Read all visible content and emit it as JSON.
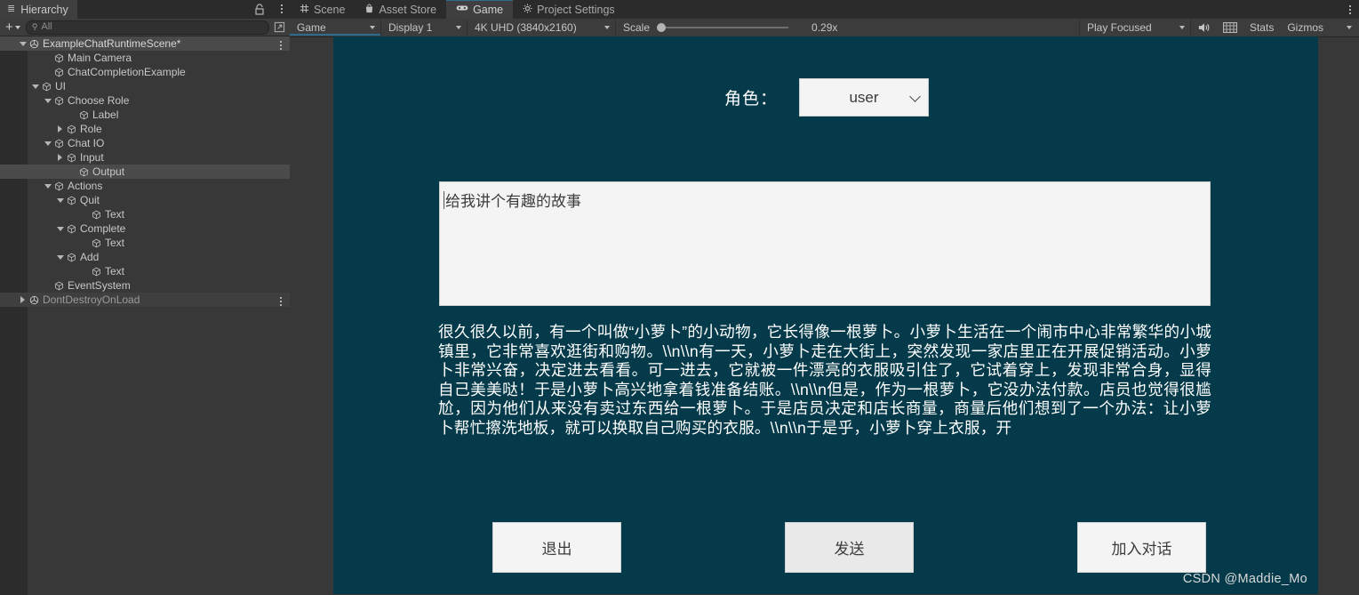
{
  "hierarchy": {
    "tab_label": "Hierarchy",
    "tab_icon": "hierarchy-icon",
    "search_placeholder": "All",
    "add_label": "+",
    "tree": [
      {
        "label": "ExampleChatRuntimeScene*",
        "depth": 0,
        "twisty": "open",
        "icon": "scene-icon",
        "state": "scene",
        "kebab": true
      },
      {
        "label": "Main Camera",
        "depth": 2,
        "twisty": "none",
        "icon": "object-icon",
        "state": "normal",
        "kebab": false
      },
      {
        "label": "ChatCompletionExample",
        "depth": 2,
        "twisty": "none",
        "icon": "object-icon",
        "state": "normal",
        "kebab": false
      },
      {
        "label": "UI",
        "depth": 1,
        "twisty": "open",
        "icon": "object-icon",
        "state": "normal",
        "kebab": false
      },
      {
        "label": "Choose Role",
        "depth": 2,
        "twisty": "open",
        "icon": "object-icon",
        "state": "normal",
        "kebab": false
      },
      {
        "label": "Label",
        "depth": 4,
        "twisty": "none",
        "icon": "object-icon",
        "state": "normal",
        "kebab": false
      },
      {
        "label": "Role",
        "depth": 3,
        "twisty": "closed",
        "icon": "object-icon",
        "state": "normal",
        "kebab": false
      },
      {
        "label": "Chat IO",
        "depth": 2,
        "twisty": "open",
        "icon": "object-icon",
        "state": "normal",
        "kebab": false
      },
      {
        "label": "Input",
        "depth": 3,
        "twisty": "closed",
        "icon": "object-icon",
        "state": "normal",
        "kebab": false
      },
      {
        "label": "Output",
        "depth": 4,
        "twisty": "none",
        "icon": "object-icon",
        "state": "selected",
        "kebab": false
      },
      {
        "label": "Actions",
        "depth": 2,
        "twisty": "open",
        "icon": "object-icon",
        "state": "normal",
        "kebab": false
      },
      {
        "label": "Quit",
        "depth": 3,
        "twisty": "open",
        "icon": "object-icon",
        "state": "normal",
        "kebab": false
      },
      {
        "label": "Text",
        "depth": 5,
        "twisty": "none",
        "icon": "object-icon",
        "state": "normal",
        "kebab": false
      },
      {
        "label": "Complete",
        "depth": 3,
        "twisty": "open",
        "icon": "object-icon",
        "state": "normal",
        "kebab": false
      },
      {
        "label": "Text",
        "depth": 5,
        "twisty": "none",
        "icon": "object-icon",
        "state": "normal",
        "kebab": false
      },
      {
        "label": "Add",
        "depth": 3,
        "twisty": "open",
        "icon": "object-icon",
        "state": "normal",
        "kebab": false
      },
      {
        "label": "Text",
        "depth": 5,
        "twisty": "none",
        "icon": "object-icon",
        "state": "normal",
        "kebab": false
      },
      {
        "label": "EventSystem",
        "depth": 2,
        "twisty": "none",
        "icon": "object-icon",
        "state": "normal",
        "kebab": false
      },
      {
        "label": "DontDestroyOnLoad",
        "depth": 0,
        "twisty": "closed",
        "icon": "scene-icon",
        "state": "dont",
        "kebab": true
      }
    ]
  },
  "editor_tabs": [
    {
      "label": "Scene",
      "icon": "grid-icon",
      "active": false
    },
    {
      "label": "Asset Store",
      "icon": "bag-icon",
      "active": false
    },
    {
      "label": "Game",
      "icon": "gamepad-icon",
      "active": true
    },
    {
      "label": "Project Settings",
      "icon": "gear-icon",
      "active": false
    }
  ],
  "game_toolbar": {
    "view_mode": "Game",
    "display": "Display 1",
    "resolution": "4K UHD (3840x2160)",
    "scale_label": "Scale",
    "scale_value": "0.29x",
    "play_mode": "Play Focused",
    "mute_icon": "speaker-icon",
    "aspect_icon": "grid-overlay-icon",
    "stats": "Stats",
    "gizmos": "Gizmos"
  },
  "game": {
    "background_color": "#043a4a",
    "role_label": "角色：",
    "role_value": "user",
    "input_value": "给我讲个有趣的故事",
    "output_text": "很久很久以前，有一个叫做“小萝卜”的小动物，它长得像一根萝卜。小萝卜生活在一个闹市中心非常繁华的小城镇里，它非常喜欢逛街和购物。\\\\n\\\\n有一天，小萝卜走在大街上，突然发现一家店里正在开展促销活动。小萝卜非常兴奋，决定进去看看。可一进去，它就被一件漂亮的衣服吸引住了，它试着穿上，发现非常合身，显得自己美美哒！于是小萝卜高兴地拿着钱准备结账。\\\\n\\\\n但是，作为一根萝卜，它没办法付款。店员也觉得很尴尬，因为他们从来没有卖过东西给一根萝卜。于是店员决定和店长商量，商量后他们想到了一个办法：让小萝卜帮忙擦洗地板，就可以换取自己购买的衣服。\\\\n\\\\n于是乎，小萝卜穿上衣服，开",
    "buttons": [
      {
        "label": "退出",
        "name": "quit-button",
        "hover": false
      },
      {
        "label": "发送",
        "name": "send-button",
        "hover": true
      },
      {
        "label": "加入对话",
        "name": "add-chat-button",
        "hover": false
      }
    ]
  },
  "watermark": "CSDN @Maddie_Mo"
}
